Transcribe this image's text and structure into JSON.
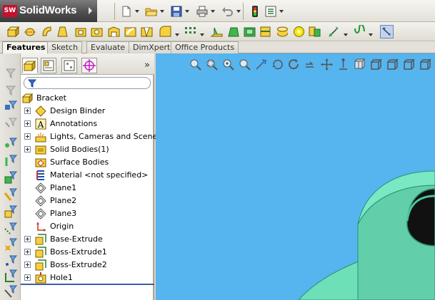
{
  "app": {
    "name": "SolidWorks",
    "logo_mark": "SW"
  },
  "quick_access": [
    {
      "icon": "new-document-icon",
      "has_dropdown": true
    },
    {
      "icon": "open-folder-icon",
      "has_dropdown": true
    },
    {
      "icon": "save-icon",
      "has_dropdown": true
    },
    {
      "icon": "print-icon",
      "has_dropdown": true
    },
    {
      "icon": "undo-icon",
      "has_dropdown": true
    },
    {
      "icon": "rebuild-icon",
      "has_dropdown": false
    },
    {
      "icon": "options-icon",
      "has_dropdown": true
    }
  ],
  "command_tabs": [
    {
      "label": "Features",
      "active": true
    },
    {
      "label": "Sketch",
      "active": false
    },
    {
      "label": "Evaluate",
      "active": false
    },
    {
      "label": "DimXpert",
      "active": false
    },
    {
      "label": "Office Products",
      "active": false
    }
  ],
  "feature_manager": {
    "expand_label": "»",
    "root": "Bracket",
    "items": [
      {
        "label": "Design Binder",
        "icon": "design-binder-icon",
        "expandable": true
      },
      {
        "label": "Annotations",
        "icon": "annotations-icon",
        "expandable": true
      },
      {
        "label": "Lights, Cameras and Scene",
        "icon": "lights-icon",
        "expandable": true
      },
      {
        "label": "Solid Bodies(1)",
        "icon": "solid-bodies-icon",
        "expandable": true
      },
      {
        "label": "Surface Bodies",
        "icon": "surface-bodies-icon",
        "expandable": false
      },
      {
        "label": "Material <not specified>",
        "icon": "material-icon",
        "expandable": false
      },
      {
        "label": "Plane1",
        "icon": "plane-icon",
        "expandable": false
      },
      {
        "label": "Plane2",
        "icon": "plane-icon",
        "expandable": false
      },
      {
        "label": "Plane3",
        "icon": "plane-icon",
        "expandable": false
      },
      {
        "label": "Origin",
        "icon": "origin-icon",
        "expandable": false
      },
      {
        "label": "Base-Extrude",
        "icon": "extrude-icon",
        "expandable": true
      },
      {
        "label": "Boss-Extrude1",
        "icon": "extrude-icon",
        "expandable": true
      },
      {
        "label": "Boss-Extrude2",
        "icon": "extrude-icon",
        "expandable": true
      },
      {
        "label": "Hole1",
        "icon": "hole-icon",
        "expandable": true
      }
    ]
  },
  "colors": {
    "viewport_bg": "#56b4ee",
    "model_face": "#6ee0b8",
    "model_shade": "#4fc59b",
    "brand_red": "#c8102e"
  }
}
